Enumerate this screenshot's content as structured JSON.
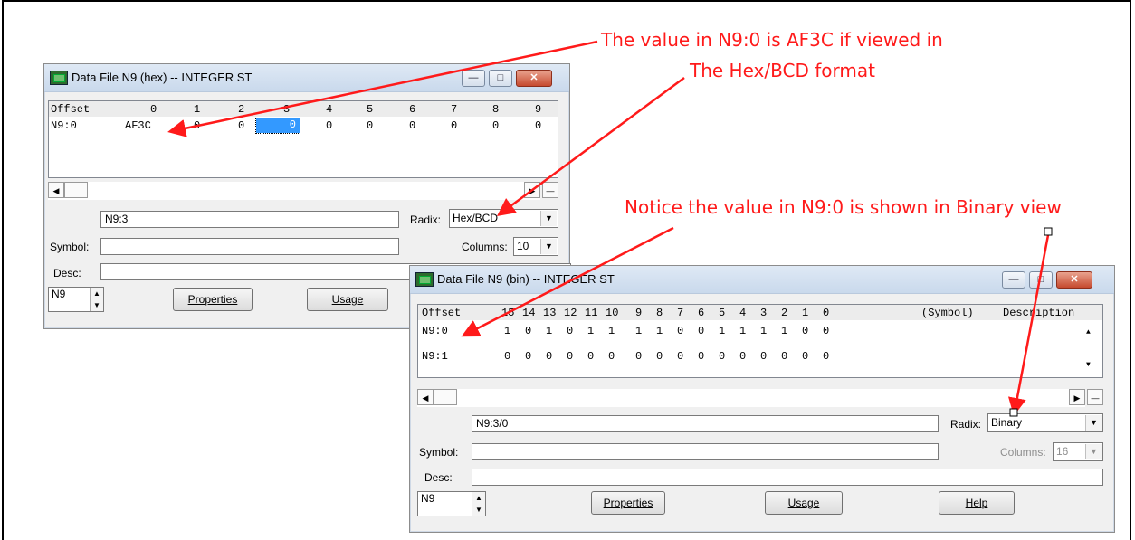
{
  "annotations": {
    "hex_line1": "The value in N9:0 is AF3C if viewed in",
    "hex_line2": "The Hex/BCD format",
    "bin_note": "Notice the value in N9:0 is shown in Binary view"
  },
  "hex_window": {
    "title": "Data File N9 (hex)  --  INTEGER ST",
    "columns": [
      "Offset",
      "0",
      "1",
      "2",
      "3",
      "4",
      "5",
      "6",
      "7",
      "8",
      "9"
    ],
    "rows": [
      {
        "offset": "N9:0",
        "values": [
          "AF3C",
          "0",
          "0",
          "0",
          "0",
          "0",
          "0",
          "0",
          "0",
          "0"
        ]
      }
    ],
    "address": "N9:3",
    "radix_label": "Radix:",
    "radix_value": "Hex/BCD",
    "symbol_label": "Symbol:",
    "symbol_value": "",
    "columns_label": "Columns:",
    "columns_value": "10",
    "desc_label": "Desc:",
    "desc_value": "",
    "file_value": "N9",
    "properties_label": "Properties",
    "usage_label": "Usage"
  },
  "bin_window": {
    "title": "Data File N9 (bin)  --  INTEGER ST",
    "columns": [
      "Offset",
      "15",
      "14",
      "13",
      "12",
      "11",
      "10",
      "9",
      "8",
      "7",
      "6",
      "5",
      "4",
      "3",
      "2",
      "1",
      "0",
      "(Symbol)",
      "Description"
    ],
    "rows": [
      {
        "offset": "N9:0",
        "values": [
          "1",
          "0",
          "1",
          "0",
          "1",
          "1",
          "1",
          "1",
          "0",
          "0",
          "1",
          "1",
          "1",
          "1",
          "0",
          "0"
        ]
      },
      {
        "offset": "N9:1",
        "values": [
          "0",
          "0",
          "0",
          "0",
          "0",
          "0",
          "0",
          "0",
          "0",
          "0",
          "0",
          "0",
          "0",
          "0",
          "0",
          "0"
        ]
      }
    ],
    "address": "N9:3/0",
    "radix_label": "Radix:",
    "radix_value": "Binary",
    "symbol_label": "Symbol:",
    "symbol_value": "",
    "columns_label": "Columns:",
    "columns_value": "16",
    "desc_label": "Desc:",
    "desc_value": "",
    "file_value": "N9",
    "properties_label": "Properties",
    "usage_label": "Usage",
    "help_label": "Help"
  },
  "colors": {
    "annotation": "#ff1a1a",
    "selection": "#3399ff",
    "close_button": "#c64a2f"
  }
}
